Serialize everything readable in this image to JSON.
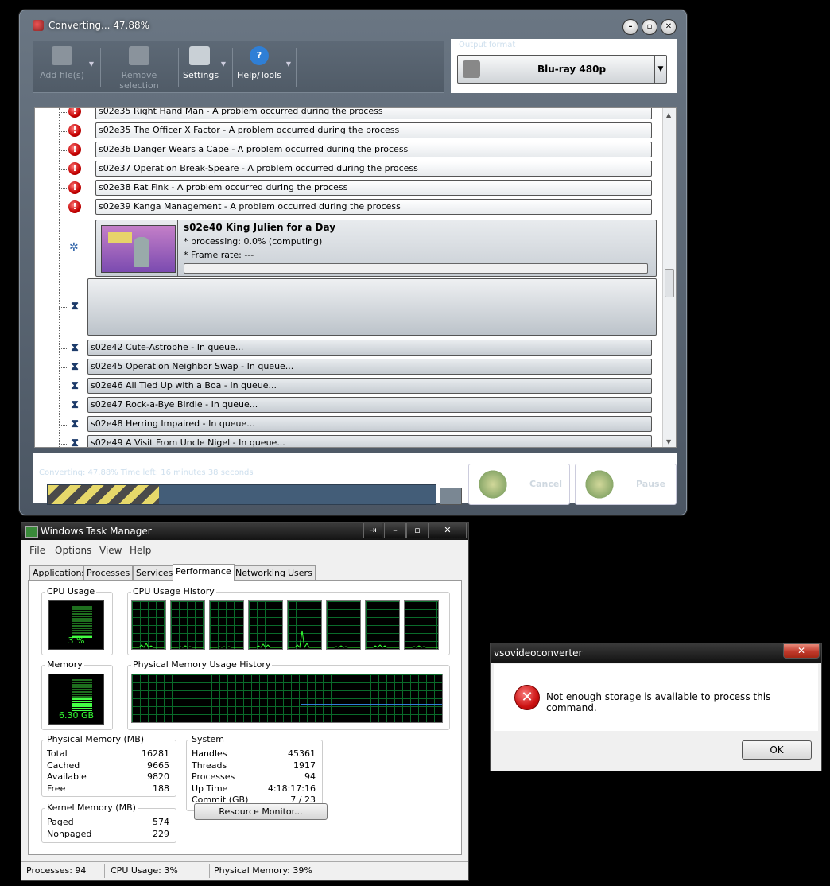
{
  "converter": {
    "title": "Converting... 47.88%",
    "toolbar": {
      "add_files": "Add file(s)",
      "remove_selection": "Remove selection",
      "settings": "Settings",
      "help_tools": "Help/Tools"
    },
    "output_format": {
      "label": "Output format",
      "value": "Blu-ray 480p"
    },
    "errors": [
      "s02e35 Right Hand Man - A problem occurred during the process",
      "s02e35 The Officer X Factor - A problem occurred during the process",
      "s02e36 Danger Wears a Cape - A problem occurred during the process",
      "s02e37 Operation Break-Speare - A problem occurred during the process",
      "s02e38 Rat Fink - A problem occurred during the process",
      "s02e39 Kanga Management - A problem occurred during the process"
    ],
    "processing": {
      "name": "s02e40 King Julien for a Day",
      "line1": "* processing: 0.0% (computing)",
      "line2": "* Frame rate: ---",
      "progress": 0.0
    },
    "queue": [
      "s02e42 Cute-Astrophe - In queue...",
      "s02e45 Operation Neighbor Swap - In queue...",
      "s02e46 All Tied Up with a Boa - In queue...",
      "s02e47 Rock-a-Bye Birdie - In queue...",
      "s02e48 Herring Impaired - In queue...",
      "s02e49 A Visit From Uncle Nigel - In queue..."
    ],
    "status": "Converting: 47.88% Time left: 16 minutes 38 seconds",
    "overall_progress": 0.4788,
    "cancel": "Cancel",
    "pause": "Pause"
  },
  "taskmgr": {
    "title": "Windows Task Manager",
    "menu": [
      "File",
      "Options",
      "View",
      "Help"
    ],
    "tabs": [
      "Applications",
      "Processes",
      "Services",
      "Performance",
      "Networking",
      "Users"
    ],
    "selected_tab": "Performance",
    "cpu_usage_label": "CPU Usage",
    "cpu_usage_value": "3 %",
    "cpu_level": 0.03,
    "cpu_history_label": "CPU Usage History",
    "memory_label": "Memory",
    "memory_value": "6.30 GB",
    "memory_level": 0.39,
    "mem_history_label": "Physical Memory Usage History",
    "physical_memory": {
      "label": "Physical Memory (MB)",
      "rows": [
        {
          "k": "Total",
          "v": "16281"
        },
        {
          "k": "Cached",
          "v": "9665"
        },
        {
          "k": "Available",
          "v": "9820"
        },
        {
          "k": "Free",
          "v": "188"
        }
      ]
    },
    "kernel_memory": {
      "label": "Kernel Memory (MB)",
      "rows": [
        {
          "k": "Paged",
          "v": "574"
        },
        {
          "k": "Nonpaged",
          "v": "229"
        }
      ]
    },
    "system": {
      "label": "System",
      "rows": [
        {
          "k": "Handles",
          "v": "45361"
        },
        {
          "k": "Threads",
          "v": "1917"
        },
        {
          "k": "Processes",
          "v": "94"
        },
        {
          "k": "Up Time",
          "v": "4:18:17:16"
        },
        {
          "k": "Commit (GB)",
          "v": "7 / 23"
        }
      ]
    },
    "resource_monitor": "Resource Monitor...",
    "statusbar": {
      "processes": "Processes: 94",
      "cpu": "CPU Usage: 3%",
      "memory": "Physical Memory: 39%"
    }
  },
  "dialog": {
    "title": "vsovideoconverter",
    "message": "Not enough storage is available to process this command.",
    "ok": "OK",
    "close": "✕"
  },
  "colors": {
    "error_red": "#c40000",
    "graph_green": "#33ff33",
    "mem_line": "#2f7fd6"
  }
}
